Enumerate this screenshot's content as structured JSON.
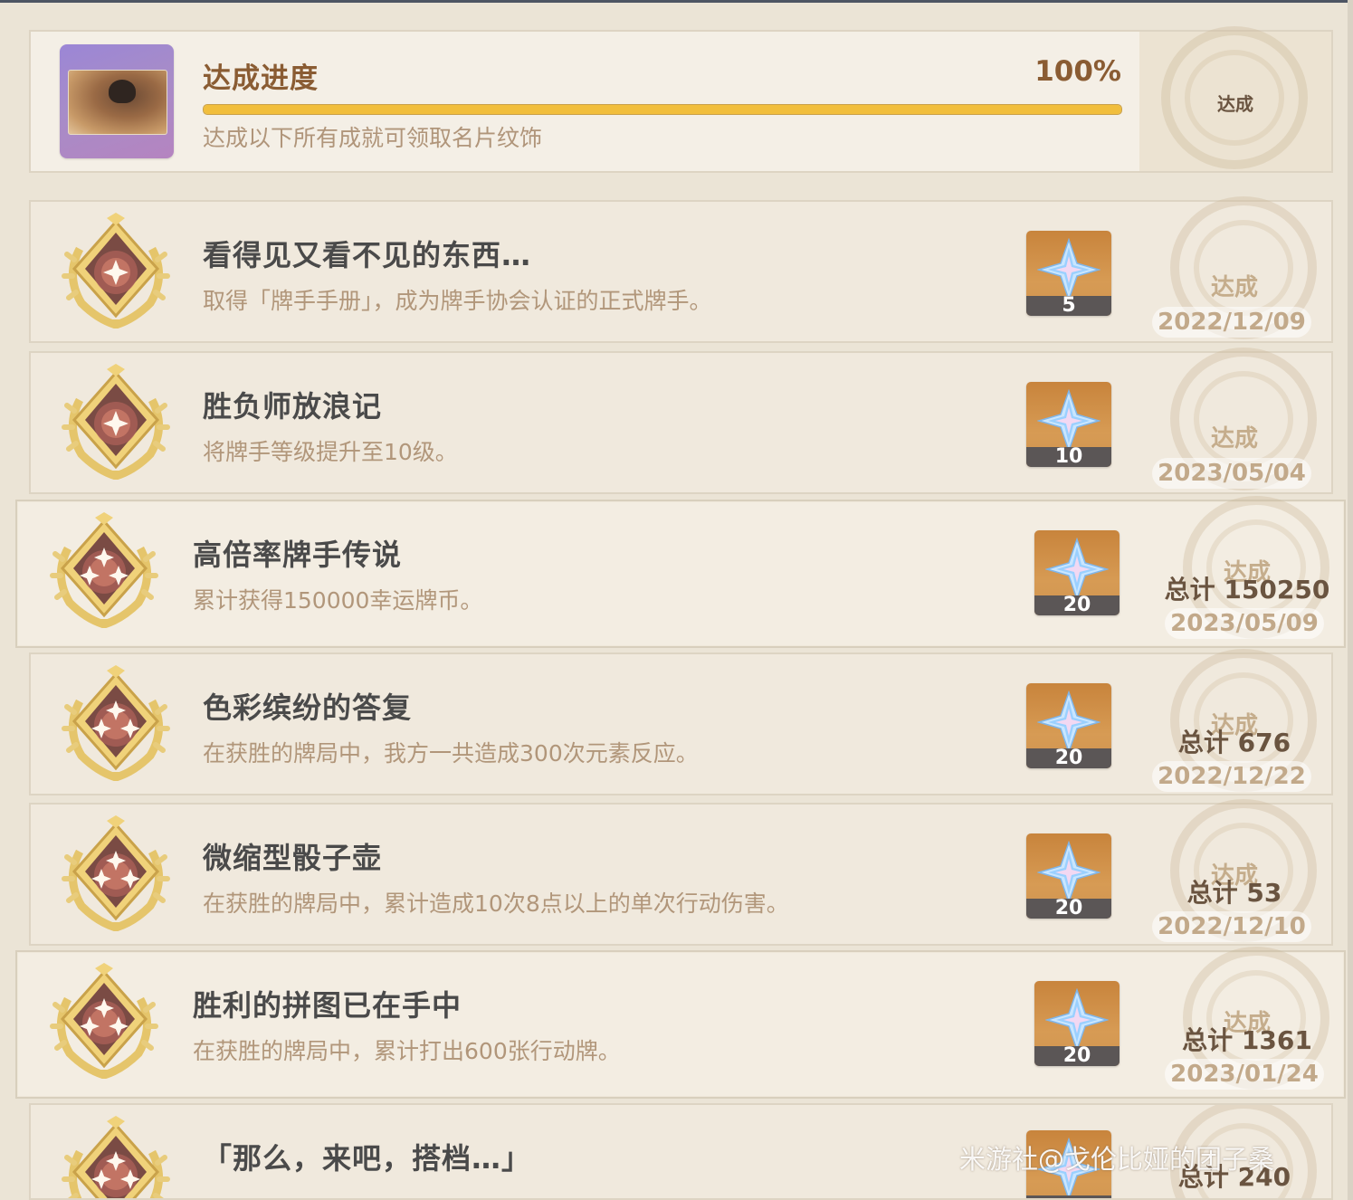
{
  "progress": {
    "title": "达成进度",
    "percent_text": "100%",
    "percent": 1.0,
    "subtitle": "达成以下所有成就可领取名片纹饰",
    "stamp_label": "达成"
  },
  "achievements": [
    {
      "title": "看得见又看不见的东西…",
      "description": "取得「牌手手册」，成为牌手协会认证的正式牌手。",
      "reward": "5",
      "status": "达成",
      "total": "",
      "date": "2022/12/09",
      "stars": 1
    },
    {
      "title": "胜负师放浪记",
      "description": "将牌手等级提升至10级。",
      "reward": "10",
      "status": "达成",
      "total": "",
      "date": "2023/05/04",
      "stars": 1
    },
    {
      "title": "高倍率牌手传说",
      "description": "累计获得150000幸运牌币。",
      "reward": "20",
      "status": "达成",
      "total": "总计 150250",
      "date": "2023/05/09",
      "stars": 3
    },
    {
      "title": "色彩缤纷的答复",
      "description": "在获胜的牌局中，我方一共造成300次元素反应。",
      "reward": "20",
      "status": "达成",
      "total": "总计 676",
      "date": "2022/12/22",
      "stars": 3
    },
    {
      "title": "微缩型骰子壶",
      "description": "在获胜的牌局中，累计造成10次8点以上的单次行动伤害。",
      "reward": "20",
      "status": "达成",
      "total": "总计 53",
      "date": "2022/12/10",
      "stars": 3
    },
    {
      "title": "胜利的拼图已在手中",
      "description": "在获胜的牌局中，累计打出600张行动牌。",
      "reward": "20",
      "status": "达成",
      "total": "总计 1361",
      "date": "2023/01/24",
      "stars": 3
    },
    {
      "title": "「那么，来吧，搭档…」",
      "description": "",
      "reward": "",
      "status": "",
      "total": "总计 240",
      "date": "",
      "stars": 3
    }
  ],
  "watermark": "米游社@戈伦比娅的团子桑",
  "colors": {
    "accent": "#8a5c33",
    "bar": "#f1be3c",
    "title": "#4a4a4a",
    "desc": "#b1967a"
  }
}
